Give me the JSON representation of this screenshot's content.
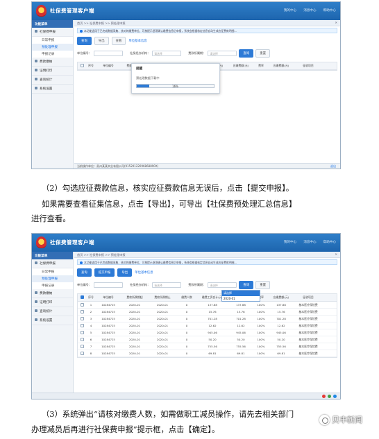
{
  "app": {
    "title": "社保费管理客户端",
    "top_links": [
      "我的中心",
      "消息中心",
      "帮助中心"
    ]
  },
  "sidebar": {
    "header": "功能菜单",
    "items": [
      {
        "label": "社保费申报",
        "subs": [
          "日常申报",
          "预处理申报",
          "申报记录"
        ]
      },
      {
        "label": "费款缴纳"
      },
      {
        "label": "证明打印"
      },
      {
        "label": "查询统计"
      },
      {
        "label": "系统设置"
      }
    ]
  },
  "crumb": "首页 >> 社保费申报 >> 预处理申报",
  "notice": "本功能适用于已完成数据采集、核对的缴费单位，可按提示逐项确认缴费信息后申报，系统会根据核定信息自动生成应征费款明细...",
  "toolbar": {
    "query": "查询",
    "export": "导出",
    "submit": "提交申报",
    "preview": "查看",
    "link": "单位基本信息"
  },
  "filters": {
    "unit_no_label": "单位编号：",
    "org_label": "社保经办机构：",
    "period_label": "费款所属期：",
    "placeholder": "请选择",
    "query": "查询",
    "reset": "重置"
  },
  "table": {
    "headers": [
      "序号",
      "单位编号",
      "费款所属期起",
      "费款所属期止",
      "缴费人数",
      "缴费工资合计(元)",
      "应缴费额(元)",
      "费率",
      "应缴费额(元)",
      "征收项目"
    ],
    "rows": [
      [
        "1",
        "10284725",
        "2020-01",
        "2020-01",
        "0",
        "137.88",
        "137.88",
        "100%",
        "137.88",
        "基本医疗保险费"
      ],
      [
        "2",
        "10284725",
        "2020-01",
        "2020-01",
        "0",
        "15.76",
        "15.76",
        "100%",
        "15.76",
        "基本医疗保险费"
      ],
      [
        "3",
        "10284725",
        "2020-01",
        "2020-01",
        "0",
        "701.28",
        "701.28",
        "100%",
        "701.28",
        "基本医疗保险费"
      ],
      [
        "4",
        "10284725",
        "2020-01",
        "2020-01",
        "0",
        "12.62",
        "12.62",
        "100%",
        "12.62",
        "基本医疗保险费"
      ],
      [
        "5",
        "10284725",
        "2020-01",
        "2020-01",
        "0",
        "945.06",
        "945.06",
        "100%",
        "945.06",
        "基本医疗保险费"
      ],
      [
        "6",
        "10284725",
        "2020-01",
        "2020-01",
        "0",
        "50.20",
        "50.20",
        "100%",
        "50.20",
        "基本医疗保险费"
      ],
      [
        "7",
        "10284725",
        "2020-01",
        "2020-01",
        "0",
        "755.56",
        "755.56",
        "100%",
        "755.56",
        "基本医疗保险费"
      ],
      [
        "8",
        "10284725",
        "2020-01",
        "2020-01",
        "0",
        "69.81",
        "69.81",
        "100%",
        "69.81",
        "基本医疗保险费"
      ]
    ]
  },
  "dialog": {
    "title": "提醒",
    "message": "预处理数据下载中",
    "progress_label": "16%",
    "progress": 0.16
  },
  "dropdown": {
    "options": [
      "请选择",
      "2020-01"
    ]
  },
  "status": {
    "unit": "当前操作单位：贵州某某实业有限公司(91520122096868890X)",
    "right": "退出"
  },
  "text": {
    "p1": "（2）勾选应征费款信息，核实应征费款信息无误后，点击【提交申报】。",
    "p2": "如果需要查看征集信息，点击【导出】，可导出【社保费预处理汇总信息】",
    "p3": "进行查看。",
    "p4": "（3）系统弹出“请核对缴费人数，如需做职工减员操作，请先去相关部门",
    "p5": "办理减员后再进行社保费申报”提示框，点击【确定】。"
  },
  "watermark": "贝丰新闻"
}
